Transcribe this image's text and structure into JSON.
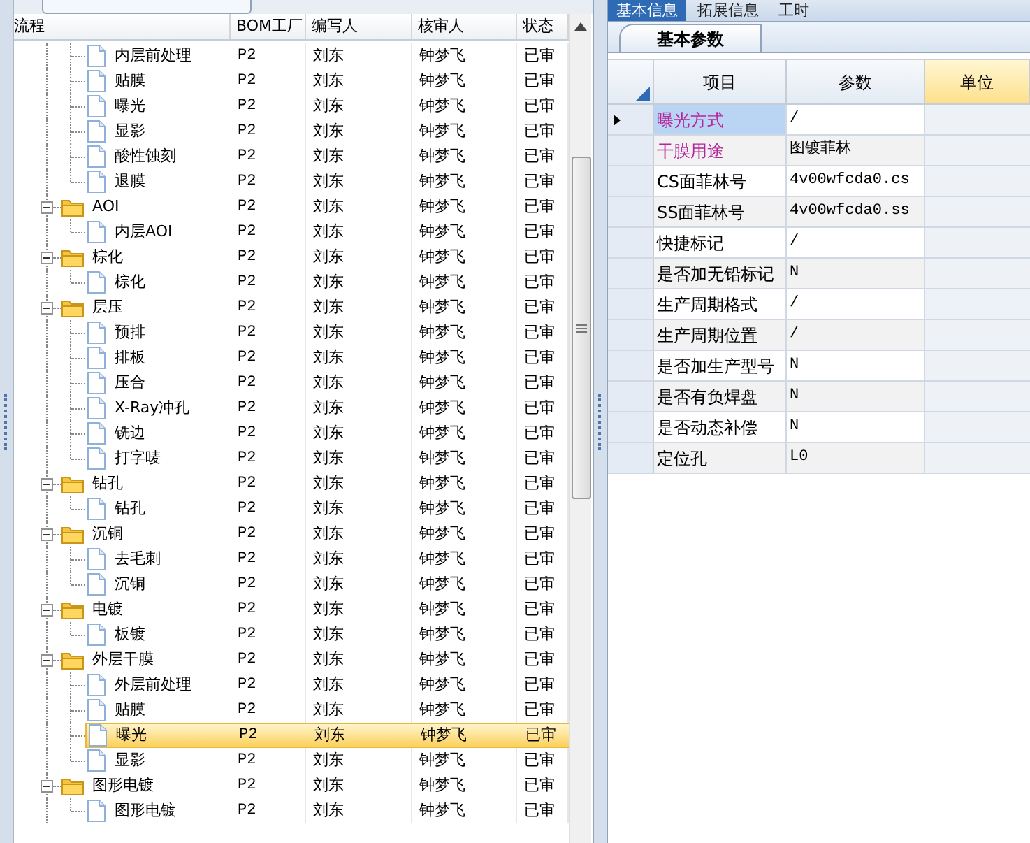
{
  "tree_table": {
    "columns": [
      "流程",
      "BOM工厂",
      "编写人",
      "核审人",
      "状态"
    ],
    "groups": [
      {
        "children": [
          {
            "label": "内层前处理",
            "factory": "P2",
            "writer": "刘东",
            "reviewer": "钟梦飞",
            "status": "已审",
            "selected": false
          },
          {
            "label": "贴膜",
            "factory": "P2",
            "writer": "刘东",
            "reviewer": "钟梦飞",
            "status": "已审",
            "selected": false
          },
          {
            "label": "曝光",
            "factory": "P2",
            "writer": "刘东",
            "reviewer": "钟梦飞",
            "status": "已审",
            "selected": false
          },
          {
            "label": "显影",
            "factory": "P2",
            "writer": "刘东",
            "reviewer": "钟梦飞",
            "status": "已审",
            "selected": false
          },
          {
            "label": "酸性蚀刻",
            "factory": "P2",
            "writer": "刘东",
            "reviewer": "钟梦飞",
            "status": "已审",
            "selected": false
          },
          {
            "label": "退膜",
            "factory": "P2",
            "writer": "刘东",
            "reviewer": "钟梦飞",
            "status": "已审",
            "selected": false
          }
        ]
      },
      {
        "label": "AOI",
        "factory": "P2",
        "writer": "刘东",
        "reviewer": "钟梦飞",
        "status": "已审",
        "expanded": true,
        "children": [
          {
            "label": "内层AOI",
            "factory": "P2",
            "writer": "刘东",
            "reviewer": "钟梦飞",
            "status": "已审",
            "selected": false
          }
        ]
      },
      {
        "label": "棕化",
        "factory": "P2",
        "writer": "刘东",
        "reviewer": "钟梦飞",
        "status": "已审",
        "expanded": true,
        "children": [
          {
            "label": "棕化",
            "factory": "P2",
            "writer": "刘东",
            "reviewer": "钟梦飞",
            "status": "已审",
            "selected": false
          }
        ]
      },
      {
        "label": "层压",
        "factory": "P2",
        "writer": "刘东",
        "reviewer": "钟梦飞",
        "status": "已审",
        "expanded": true,
        "children": [
          {
            "label": "预排",
            "factory": "P2",
            "writer": "刘东",
            "reviewer": "钟梦飞",
            "status": "已审",
            "selected": false
          },
          {
            "label": "排板",
            "factory": "P2",
            "writer": "刘东",
            "reviewer": "钟梦飞",
            "status": "已审",
            "selected": false
          },
          {
            "label": "压合",
            "factory": "P2",
            "writer": "刘东",
            "reviewer": "钟梦飞",
            "status": "已审",
            "selected": false
          },
          {
            "label": "X-Ray冲孔",
            "factory": "P2",
            "writer": "刘东",
            "reviewer": "钟梦飞",
            "status": "已审",
            "selected": false
          },
          {
            "label": "铣边",
            "factory": "P2",
            "writer": "刘东",
            "reviewer": "钟梦飞",
            "status": "已审",
            "selected": false
          },
          {
            "label": "打字唛",
            "factory": "P2",
            "writer": "刘东",
            "reviewer": "钟梦飞",
            "status": "已审",
            "selected": false
          }
        ]
      },
      {
        "label": "钻孔",
        "factory": "P2",
        "writer": "刘东",
        "reviewer": "钟梦飞",
        "status": "已审",
        "expanded": true,
        "children": [
          {
            "label": "钻孔",
            "factory": "P2",
            "writer": "刘东",
            "reviewer": "钟梦飞",
            "status": "已审",
            "selected": false
          }
        ]
      },
      {
        "label": "沉铜",
        "factory": "P2",
        "writer": "刘东",
        "reviewer": "钟梦飞",
        "status": "已审",
        "expanded": true,
        "children": [
          {
            "label": "去毛刺",
            "factory": "P2",
            "writer": "刘东",
            "reviewer": "钟梦飞",
            "status": "已审",
            "selected": false
          },
          {
            "label": "沉铜",
            "factory": "P2",
            "writer": "刘东",
            "reviewer": "钟梦飞",
            "status": "已审",
            "selected": false
          }
        ]
      },
      {
        "label": "电镀",
        "factory": "P2",
        "writer": "刘东",
        "reviewer": "钟梦飞",
        "status": "已审",
        "expanded": true,
        "children": [
          {
            "label": "板镀",
            "factory": "P2",
            "writer": "刘东",
            "reviewer": "钟梦飞",
            "status": "已审",
            "selected": false
          }
        ]
      },
      {
        "label": "外层干膜",
        "factory": "P2",
        "writer": "刘东",
        "reviewer": "钟梦飞",
        "status": "已审",
        "expanded": true,
        "children": [
          {
            "label": "外层前处理",
            "factory": "P2",
            "writer": "刘东",
            "reviewer": "钟梦飞",
            "status": "已审",
            "selected": false
          },
          {
            "label": "贴膜",
            "factory": "P2",
            "writer": "刘东",
            "reviewer": "钟梦飞",
            "status": "已审",
            "selected": false
          },
          {
            "label": "曝光",
            "factory": "P2",
            "writer": "刘东",
            "reviewer": "钟梦飞",
            "status": "已审",
            "selected": true
          },
          {
            "label": "显影",
            "factory": "P2",
            "writer": "刘东",
            "reviewer": "钟梦飞",
            "status": "已审",
            "selected": false
          }
        ]
      },
      {
        "label": "图形电镀",
        "factory": "P2",
        "writer": "刘东",
        "reviewer": "钟梦飞",
        "status": "已审",
        "expanded": true,
        "children": [
          {
            "label": "图形电镀",
            "factory": "P2",
            "writer": "刘东",
            "reviewer": "钟梦飞",
            "status": "已审",
            "selected": false
          }
        ]
      }
    ]
  },
  "tabs": [
    {
      "label": "基本信息",
      "selected": true
    },
    {
      "label": "拓展信息",
      "selected": false
    },
    {
      "label": "工时",
      "selected": false
    }
  ],
  "sub_tab": {
    "label": "基本参数"
  },
  "param_table": {
    "columns": [
      "项目",
      "参数",
      "单位"
    ],
    "rows": [
      {
        "item": "曝光方式",
        "value": "/",
        "highlighted": true,
        "selected": true
      },
      {
        "item": "干膜用途",
        "value": "图镀菲林",
        "highlighted": true,
        "selected": false
      },
      {
        "item": "CS面菲林号",
        "value": "4v00wfcda0.cs",
        "highlighted": false,
        "selected": false
      },
      {
        "item": "SS面菲林号",
        "value": "4v00wfcda0.ss",
        "highlighted": false,
        "selected": false
      },
      {
        "item": "快捷标记",
        "value": "/",
        "highlighted": false,
        "selected": false
      },
      {
        "item": "是否加无铅标记",
        "value": "N",
        "highlighted": false,
        "selected": false
      },
      {
        "item": "生产周期格式",
        "value": "/",
        "highlighted": false,
        "selected": false
      },
      {
        "item": "生产周期位置",
        "value": "/",
        "highlighted": false,
        "selected": false
      },
      {
        "item": "是否加生产型号",
        "value": "N",
        "highlighted": false,
        "selected": false
      },
      {
        "item": "是否有负焊盘",
        "value": "N",
        "highlighted": false,
        "selected": false
      },
      {
        "item": "是否动态补偿",
        "value": "N",
        "highlighted": false,
        "selected": false
      },
      {
        "item": "定位孔",
        "value": "L0",
        "highlighted": false,
        "selected": false
      }
    ]
  }
}
